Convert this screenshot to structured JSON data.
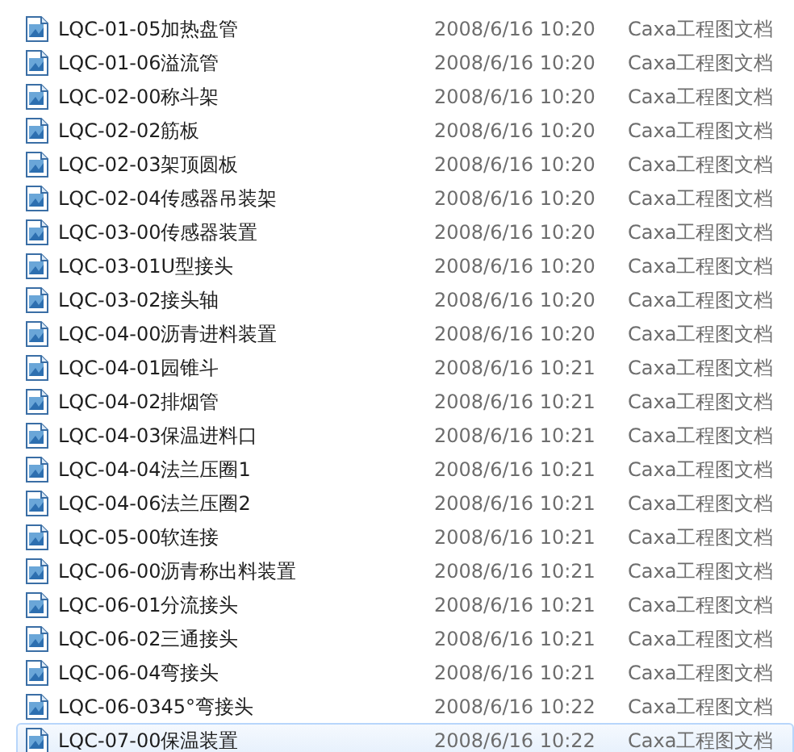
{
  "files": [
    {
      "name": "LQC-01-05加热盘管",
      "modified": "2008/6/16 10:20",
      "type": "Caxa工程图文档",
      "selected": false
    },
    {
      "name": "LQC-01-06溢流管",
      "modified": "2008/6/16 10:20",
      "type": "Caxa工程图文档",
      "selected": false
    },
    {
      "name": "LQC-02-00称斗架",
      "modified": "2008/6/16 10:20",
      "type": "Caxa工程图文档",
      "selected": false
    },
    {
      "name": "LQC-02-02筋板",
      "modified": "2008/6/16 10:20",
      "type": "Caxa工程图文档",
      "selected": false
    },
    {
      "name": "LQC-02-03架顶圆板",
      "modified": "2008/6/16 10:20",
      "type": "Caxa工程图文档",
      "selected": false
    },
    {
      "name": "LQC-02-04传感器吊装架",
      "modified": "2008/6/16 10:20",
      "type": "Caxa工程图文档",
      "selected": false
    },
    {
      "name": "LQC-03-00传感器装置",
      "modified": "2008/6/16 10:20",
      "type": "Caxa工程图文档",
      "selected": false
    },
    {
      "name": "LQC-03-01U型接头",
      "modified": "2008/6/16 10:20",
      "type": "Caxa工程图文档",
      "selected": false
    },
    {
      "name": "LQC-03-02接头轴",
      "modified": "2008/6/16 10:20",
      "type": "Caxa工程图文档",
      "selected": false
    },
    {
      "name": "LQC-04-00沥青进料装置",
      "modified": "2008/6/16 10:20",
      "type": "Caxa工程图文档",
      "selected": false
    },
    {
      "name": "LQC-04-01园锥斗",
      "modified": "2008/6/16 10:21",
      "type": "Caxa工程图文档",
      "selected": false
    },
    {
      "name": "LQC-04-02排烟管",
      "modified": "2008/6/16 10:21",
      "type": "Caxa工程图文档",
      "selected": false
    },
    {
      "name": "LQC-04-03保温进料口",
      "modified": "2008/6/16 10:21",
      "type": "Caxa工程图文档",
      "selected": false
    },
    {
      "name": "LQC-04-04法兰压圈1",
      "modified": "2008/6/16 10:21",
      "type": "Caxa工程图文档",
      "selected": false
    },
    {
      "name": "LQC-04-06法兰压圈2",
      "modified": "2008/6/16 10:21",
      "type": "Caxa工程图文档",
      "selected": false
    },
    {
      "name": "LQC-05-00软连接",
      "modified": "2008/6/16 10:21",
      "type": "Caxa工程图文档",
      "selected": false
    },
    {
      "name": "LQC-06-00沥青称出料装置",
      "modified": "2008/6/16 10:21",
      "type": "Caxa工程图文档",
      "selected": false
    },
    {
      "name": "LQC-06-01分流接头",
      "modified": "2008/6/16 10:21",
      "type": "Caxa工程图文档",
      "selected": false
    },
    {
      "name": "LQC-06-02三通接头",
      "modified": "2008/6/16 10:21",
      "type": "Caxa工程图文档",
      "selected": false
    },
    {
      "name": "LQC-06-04弯接头",
      "modified": "2008/6/16 10:21",
      "type": "Caxa工程图文档",
      "selected": false
    },
    {
      "name": "LQC-06-0345°弯接头",
      "modified": "2008/6/16 10:22",
      "type": "Caxa工程图文档",
      "selected": false
    },
    {
      "name": "LQC-07-00保温装置",
      "modified": "2008/6/16 10:22",
      "type": "Caxa工程图文档",
      "selected": true
    }
  ]
}
